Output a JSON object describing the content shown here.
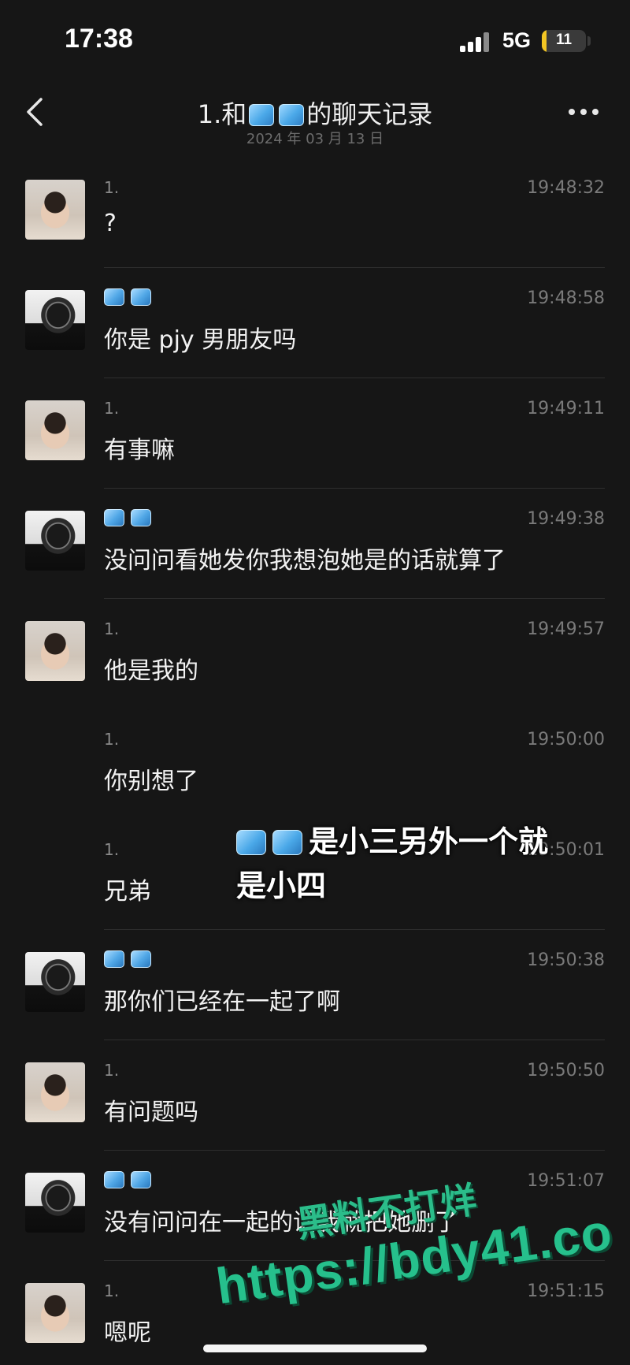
{
  "status_bar": {
    "time": "17:38",
    "network": "5G",
    "battery": "11",
    "battery_fraction": 0.11
  },
  "header": {
    "title_prefix": "1.和",
    "title_suffix": "的聊天记录",
    "date": "2024 年 03 月 13 日"
  },
  "messages": [
    {
      "sender": "1.",
      "time": "19:48:32",
      "text": "?",
      "avatar": "kid-avatar"
    },
    {
      "sender": "",
      "time": "19:48:58",
      "text": "你是 pjy 男朋友吗",
      "avatar": "man-avatar"
    },
    {
      "sender": "1.",
      "time": "19:49:11",
      "text": "有事嘛",
      "avatar": "kid-avatar"
    },
    {
      "sender": "",
      "time": "19:49:38",
      "text": "没问问看她发你我想泡她是的话就算了",
      "avatar": "man-avatar"
    },
    {
      "sender": "1.",
      "time": "19:49:57",
      "text": "他是我的",
      "avatar": "kid-avatar"
    },
    {
      "sender": "1.",
      "time": "19:50:00",
      "text": "你别想了",
      "avatar": ""
    },
    {
      "sender": "1.",
      "time": "19:50:01",
      "text": "兄弟",
      "avatar": ""
    },
    {
      "sender": "",
      "time": "19:50:38",
      "text": "那你们已经在一起了啊",
      "avatar": "man-avatar"
    },
    {
      "sender": "1.",
      "time": "19:50:50",
      "text": "有问题吗",
      "avatar": "kid-avatar"
    },
    {
      "sender": "",
      "time": "19:51:07",
      "text": "没有问问在一起的话我就把她删了",
      "avatar": "man-avatar"
    },
    {
      "sender": "1.",
      "time": "19:51:15",
      "text": "嗯呢",
      "avatar": "kid-avatar"
    }
  ],
  "overlay_caption": {
    "line1": "是小三另外一个就",
    "line2": "是小四"
  },
  "watermark": {
    "line1": "黑料不打烊",
    "line2": "https://bdy41.co"
  }
}
